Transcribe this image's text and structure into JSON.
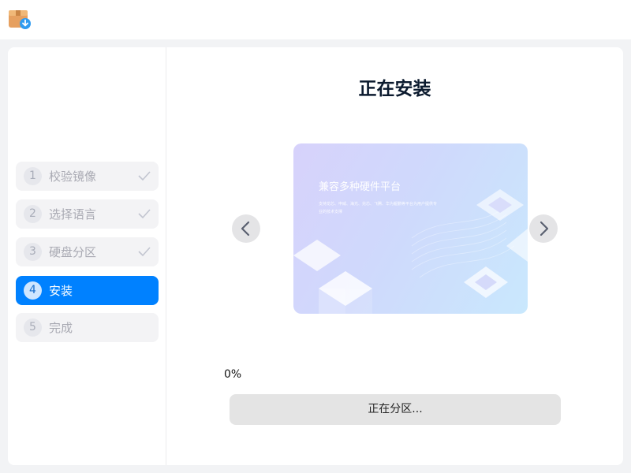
{
  "header": {
    "app_icon": "package-download-icon"
  },
  "sidebar": {
    "steps": [
      {
        "number": "1",
        "label": "校验镜像",
        "state": "done"
      },
      {
        "number": "2",
        "label": "选择语言",
        "state": "done"
      },
      {
        "number": "3",
        "label": "硬盘分区",
        "state": "done"
      },
      {
        "number": "4",
        "label": "安装",
        "state": "active"
      },
      {
        "number": "5",
        "label": "完成",
        "state": "pending"
      }
    ],
    "check_icon": "check-icon"
  },
  "main": {
    "title": "正在安装",
    "carousel": {
      "prev_icon": "chevron-left-icon",
      "next_icon": "chevron-right-icon",
      "slide_title": "兼容多种硬件平台",
      "slide_description": "支持龙芯、申威、海光、兆芯、飞腾、华为鲲鹏等平台为用户提供专业的技术支撑"
    },
    "progress": {
      "percent_label": "0%",
      "value": 0,
      "status": "正在分区..."
    }
  },
  "colors": {
    "accent": "#0081ff",
    "step_inactive_bg": "#f3f3f5",
    "progress_track": "#e4e4e4"
  }
}
